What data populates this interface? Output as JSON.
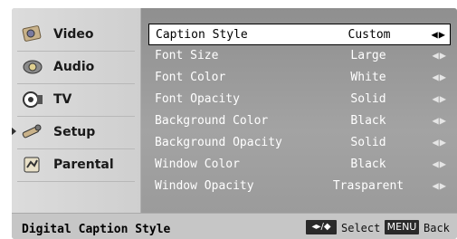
{
  "sidebar": {
    "items": [
      {
        "label": "Video",
        "icon": "video-icon"
      },
      {
        "label": "Audio",
        "icon": "audio-icon"
      },
      {
        "label": "TV",
        "icon": "tv-icon"
      },
      {
        "label": "Setup",
        "icon": "setup-icon",
        "active": true
      },
      {
        "label": "Parental",
        "icon": "parental-icon"
      }
    ]
  },
  "settings": {
    "rows": [
      {
        "label": "Caption Style",
        "value": "Custom",
        "arrows": "◀▶",
        "selected": true
      },
      {
        "label": "Font Size",
        "value": "Large",
        "arrows": "◀▶"
      },
      {
        "label": "Font Color",
        "value": "White",
        "arrows": "◀▶"
      },
      {
        "label": "Font Opacity",
        "value": "Solid",
        "arrows": "◀▶"
      },
      {
        "label": "Background Color",
        "value": "Black",
        "arrows": "◀▶"
      },
      {
        "label": "Background Opacity",
        "value": "Solid",
        "arrows": "◀▶"
      },
      {
        "label": "Window Color",
        "value": "Black",
        "arrows": "◀▶"
      },
      {
        "label": "Window Opacity",
        "value": "Trasparent",
        "arrows": "◀▶"
      }
    ]
  },
  "status": {
    "title": "Digital Caption Style",
    "nav_key": "◂▸/◆",
    "select_label": "Select",
    "menu_key": "MENU",
    "back_label": "Back"
  },
  "colors": {
    "sidebar_bg": "#d6d6d6",
    "main_bg": "#9b9b9b",
    "selected_row_bg": "#ffffff"
  }
}
